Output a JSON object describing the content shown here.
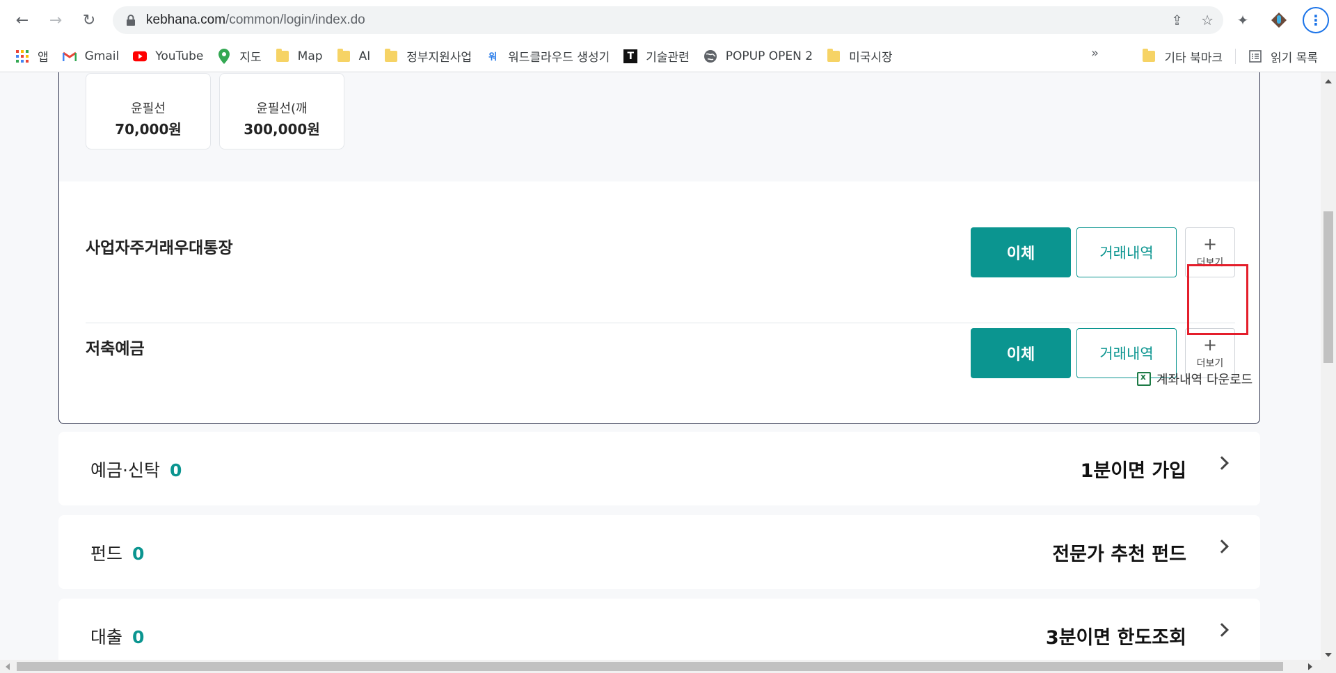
{
  "browser": {
    "url_host": "kebhana.com",
    "url_path": "/common/login/index.do",
    "bookmarks": [
      {
        "label": "앱",
        "icon": "apps-grid-icon"
      },
      {
        "label": "Gmail",
        "icon": "gmail-icon"
      },
      {
        "label": "YouTube",
        "icon": "youtube-icon"
      },
      {
        "label": "지도",
        "icon": "maps-pin-icon"
      },
      {
        "label": "Map",
        "icon": "folder-icon"
      },
      {
        "label": "AI",
        "icon": "folder-icon"
      },
      {
        "label": "정부지원사업",
        "icon": "folder-icon"
      },
      {
        "label": "워드클라우드 생성기",
        "icon": "wordcloud-icon"
      },
      {
        "label": "기술관련",
        "icon": "t-logo-icon"
      },
      {
        "label": "POPUP OPEN 2",
        "icon": "globe-icon"
      },
      {
        "label": "미국시장",
        "icon": "folder-icon"
      }
    ],
    "bookmarks_overflow": "»",
    "other_bookmarks": "기타 북마크",
    "reading_list": "읽기 목록"
  },
  "certificates": [
    {
      "name": "윤필선",
      "price": "70,000원"
    },
    {
      "name": "윤필선(깨",
      "price": "300,000원"
    }
  ],
  "accounts": [
    {
      "name": "사업자주거래우대통장",
      "transfer": "이체",
      "history": "거래내역",
      "more": "더보기"
    },
    {
      "name": "저축예금",
      "transfer": "이체",
      "history": "거래내역",
      "more": "더보기"
    }
  ],
  "download_label": "계좌내역 다운로드",
  "products": [
    {
      "name": "예금·신탁",
      "count": "0",
      "cta": "1분이면 가입"
    },
    {
      "name": "펀드",
      "count": "0",
      "cta": "전문가 추천 펀드"
    },
    {
      "name": "대출",
      "count": "0",
      "cta": "3분이면 한도조회"
    }
  ],
  "colors": {
    "accent": "#0b9590",
    "highlight": "#e41e2b"
  }
}
